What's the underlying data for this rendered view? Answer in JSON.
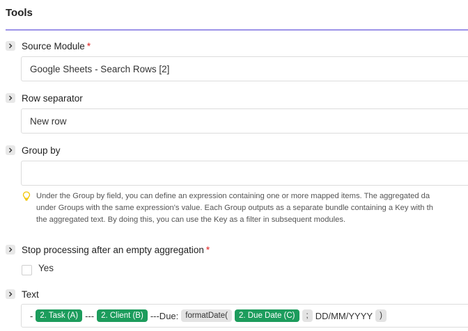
{
  "panel": {
    "title": "Tools"
  },
  "source_module": {
    "label": "Source Module",
    "required_mark": "*",
    "value": "Google Sheets - Search Rows [2]"
  },
  "row_separator": {
    "label": "Row separator",
    "value": "New row"
  },
  "group_by": {
    "label": "Group by",
    "value": "",
    "hint_lines": [
      "Under the Group by field, you can define an expression containing one or more mapped items. The aggregated da",
      "under Groups with the same expression's value. Each Group outputs as a separate bundle containing a Key with th",
      "the aggregated text. By doing this, you can use the Key as a filter in subsequent modules."
    ]
  },
  "stop_processing": {
    "label": "Stop processing after an empty aggregation",
    "required_mark": "*",
    "option_label": "Yes"
  },
  "text": {
    "label": "Text",
    "tokens": {
      "t0": "-",
      "task": "2. Task (A)",
      "t1": "---",
      "client": "2. Client (B)",
      "t2": "---Due:",
      "fn_open": "formatDate(",
      "due": "2. Due Date (C)",
      "sep": ";",
      "t3": "DD/MM/YYYY",
      "fn_close": ")"
    }
  },
  "colors": {
    "accent_rule": "#9d93e8",
    "pill_green": "#1c9c5c",
    "required_red": "#e02020",
    "hint_icon": "#f2c500"
  },
  "icons": {
    "chevron": "chevron-right-icon",
    "hint": "lightbulb-icon"
  }
}
